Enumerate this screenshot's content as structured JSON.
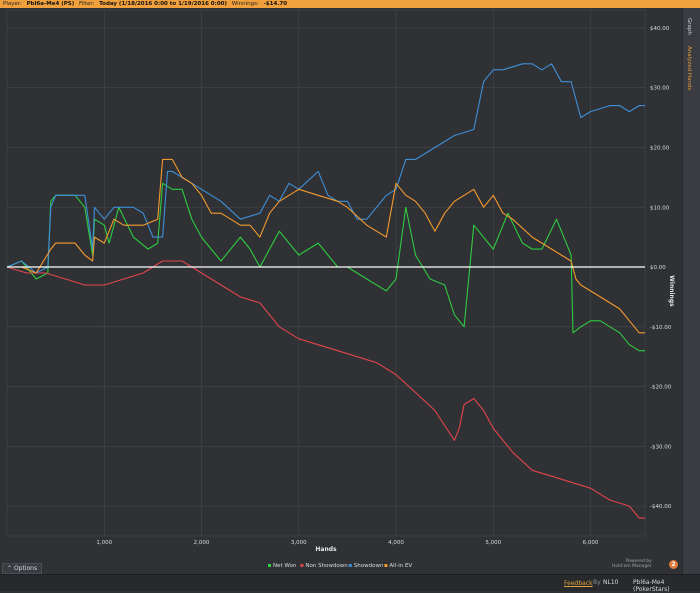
{
  "header": {
    "player_label": "Player:",
    "player_value": "Pbl6a-Me4 (PS)",
    "filter_label": "Filter:",
    "filter_value": "Today (1/18/2016 0:00 to 1/19/2016 0:00)",
    "winnings_label": "Winnings:",
    "winnings_value": "-$14.70"
  },
  "side_tabs": {
    "graph": "Graph",
    "analyzed": "Analyzed Hands"
  },
  "footer": {
    "options_label": "Options",
    "feedback_label": "Feedback",
    "separator": "By",
    "stake_label": "NL10",
    "player_label": "Pbl6a-Me4 (PokerStars)",
    "powered_by": "Powered by",
    "product_name": "Hold'em Manager",
    "product_badge": "2"
  },
  "colors": {
    "net_won": "#2ecc40",
    "non_showdown": "#e0454a",
    "showdown": "#3e8fd8",
    "all_in_ev": "#f39a2e",
    "zero_line": "#ffffff",
    "accent": "#f0a03c"
  },
  "chart_data": {
    "type": "line",
    "xlabel": "Hands",
    "ylabel": "Winnings",
    "xlim": [
      0,
      6560
    ],
    "ylim": [
      -45,
      43
    ],
    "x_ticks": [
      1000,
      2000,
      3000,
      4000,
      5000,
      6000
    ],
    "x_tick_labels": [
      "1,000",
      "2,000",
      "3,000",
      "4,000",
      "5,000",
      "6,000"
    ],
    "y_ticks": [
      40,
      30,
      20,
      10,
      0,
      -10,
      -20,
      -30,
      -40
    ],
    "y_tick_labels": [
      "$40.00",
      "$30.00",
      "$20.00",
      "$10.00",
      "$0.00",
      "-$10.00",
      "-$20.00",
      "-$30.00",
      "-$40.00"
    ],
    "grid": true,
    "legend_position": "bottom-center",
    "series": [
      {
        "name": "Net Won",
        "color_key": "net_won",
        "x": [
          0,
          150,
          300,
          420,
          450,
          500,
          700,
          800,
          880,
          900,
          1000,
          1050,
          1150,
          1300,
          1450,
          1550,
          1600,
          1700,
          1800,
          1900,
          2000,
          2100,
          2200,
          2400,
          2500,
          2600,
          2800,
          3000,
          3200,
          3400,
          3500,
          3700,
          3900,
          4000,
          4100,
          4200,
          4350,
          4500,
          4600,
          4700,
          4800,
          5000,
          5150,
          5300,
          5400,
          5500,
          5650,
          5800,
          5820,
          5900,
          6000,
          6100,
          6200,
          6300,
          6400,
          6500,
          6560
        ],
        "y": [
          0,
          1,
          -2,
          -1,
          11,
          12,
          12,
          10,
          2,
          8,
          7,
          4,
          10,
          5,
          3,
          4,
          14,
          13,
          13,
          8,
          5,
          3,
          1,
          5,
          3,
          0,
          6,
          2,
          4,
          0,
          0,
          -2,
          -4,
          -2,
          10,
          2,
          -2,
          -3,
          -8,
          -10,
          7,
          3,
          9,
          4,
          3,
          3,
          8,
          2,
          -11,
          -10,
          -9,
          -9,
          -10,
          -11,
          -13,
          -14,
          -14
        ]
      },
      {
        "name": "Non Showdown",
        "color_key": "non_showdown",
        "x": [
          0,
          200,
          400,
          600,
          800,
          1000,
          1200,
          1400,
          1600,
          1800,
          2000,
          2200,
          2400,
          2600,
          2800,
          3000,
          3200,
          3400,
          3600,
          3800,
          4000,
          4200,
          4400,
          4600,
          4650,
          4700,
          4800,
          4900,
          5000,
          5200,
          5400,
          5600,
          5800,
          6000,
          6200,
          6400,
          6500,
          6560
        ],
        "y": [
          0,
          -1,
          -1,
          -2,
          -3,
          -3,
          -2,
          -1,
          1,
          1,
          -1,
          -3,
          -5,
          -6,
          -10,
          -12,
          -13,
          -14,
          -15,
          -16,
          -18,
          -21,
          -24,
          -29,
          -27,
          -23,
          -22,
          -24,
          -27,
          -31,
          -34,
          -35,
          -36,
          -37,
          -39,
          -40,
          -42,
          -42
        ]
      },
      {
        "name": "Showdown",
        "color_key": "showdown",
        "x": [
          0,
          150,
          300,
          420,
          450,
          500,
          700,
          800,
          880,
          900,
          1000,
          1100,
          1300,
          1400,
          1500,
          1600,
          1650,
          1700,
          1800,
          1900,
          2000,
          2200,
          2400,
          2600,
          2700,
          2800,
          2900,
          3000,
          3200,
          3300,
          3400,
          3500,
          3600,
          3700,
          3900,
          4000,
          4100,
          4200,
          4300,
          4500,
          4600,
          4800,
          4900,
          5000,
          5100,
          5300,
          5400,
          5500,
          5600,
          5700,
          5800,
          5900,
          6000,
          6200,
          6300,
          6400,
          6500,
          6560
        ],
        "y": [
          0,
          1,
          -1,
          0,
          10,
          12,
          12,
          12,
          3,
          10,
          8,
          10,
          10,
          9,
          5,
          5,
          16,
          16,
          15,
          14,
          13,
          11,
          8,
          9,
          12,
          11,
          14,
          13,
          16,
          12,
          11,
          11,
          8,
          8,
          12,
          13,
          18,
          18,
          19,
          21,
          22,
          23,
          31,
          33,
          33,
          34,
          34,
          33,
          34,
          31,
          31,
          25,
          26,
          27,
          27,
          26,
          27,
          27
        ]
      },
      {
        "name": "All-in EV",
        "color_key": "all_in_ev",
        "x": [
          0,
          150,
          300,
          450,
          500,
          700,
          800,
          880,
          900,
          1000,
          1100,
          1200,
          1400,
          1550,
          1600,
          1700,
          1800,
          1900,
          2000,
          2100,
          2200,
          2400,
          2500,
          2600,
          2700,
          2800,
          3000,
          3200,
          3400,
          3500,
          3700,
          3900,
          4000,
          4100,
          4200,
          4300,
          4400,
          4500,
          4550,
          4600,
          4700,
          4800,
          4900,
          5000,
          5100,
          5200,
          5400,
          5500,
          5600,
          5700,
          5800,
          5850,
          5900,
          6000,
          6100,
          6200,
          6300,
          6400,
          6450,
          6500,
          6560
        ],
        "y": [
          0,
          0,
          -1,
          3,
          4,
          4,
          2,
          1,
          5,
          4,
          8,
          7,
          7,
          8,
          18,
          18,
          15,
          14,
          12,
          9,
          9,
          7,
          7,
          5,
          9,
          11,
          13,
          12,
          11,
          10,
          7,
          5,
          14,
          12,
          11,
          9,
          6,
          9,
          10,
          11,
          12,
          13,
          10,
          12,
          9,
          8,
          5,
          4,
          3,
          2,
          1,
          -2,
          -3,
          -4,
          -5,
          -6,
          -7,
          -9,
          -10,
          -11,
          -11
        ]
      }
    ]
  }
}
